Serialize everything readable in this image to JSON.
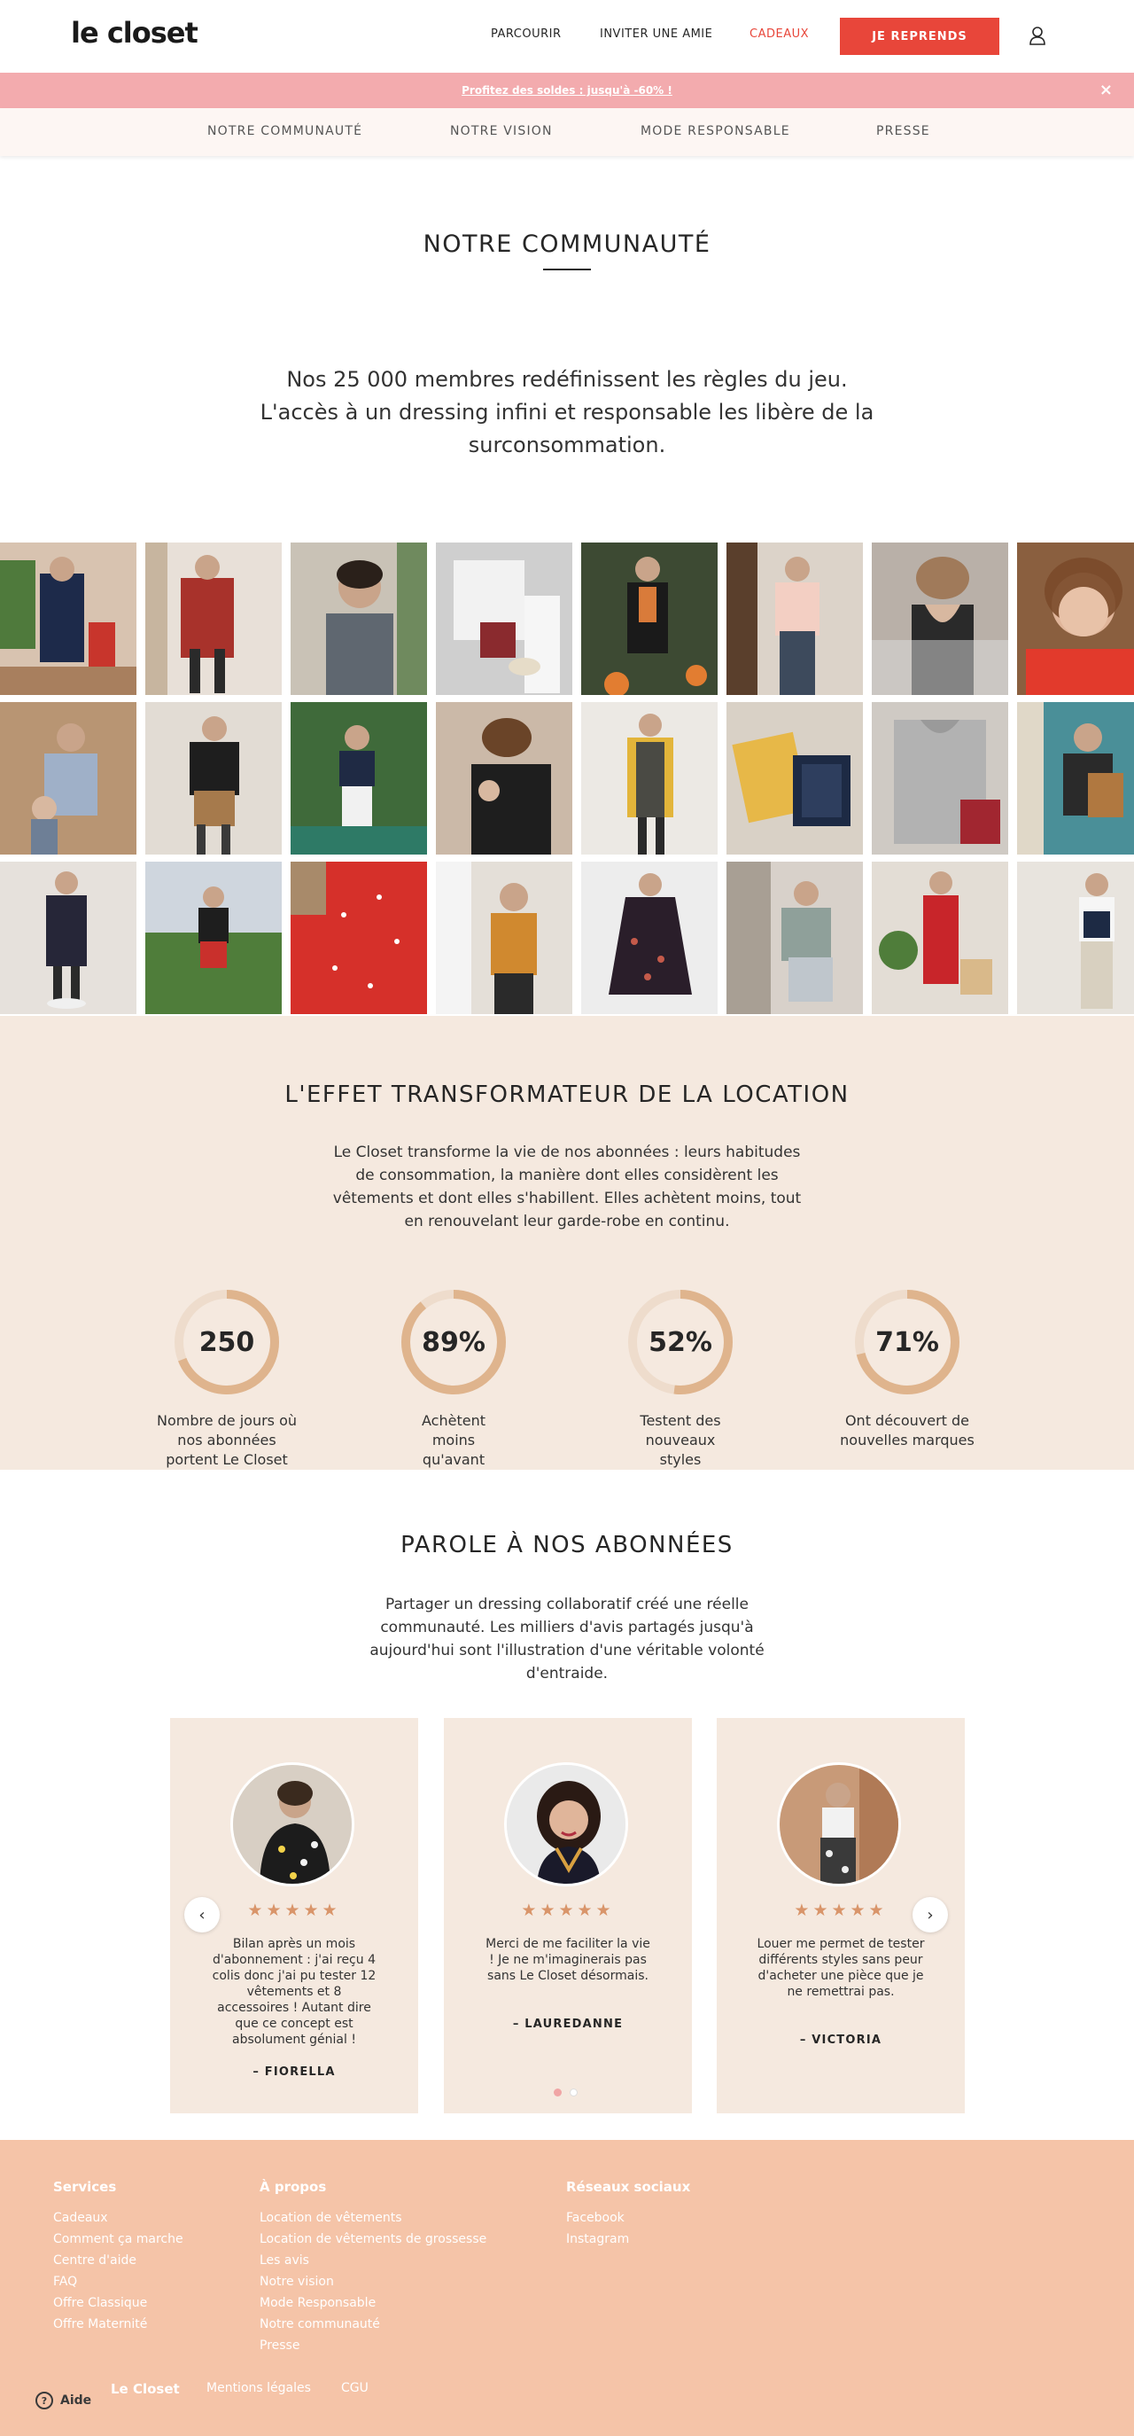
{
  "header": {
    "logo": "le closet",
    "nav": [
      "PARCOURIR",
      "INVITER UNE AMIE",
      "CADEAUX"
    ],
    "cta": "JE REPRENDS"
  },
  "promo": {
    "text": "Profitez des soldes : jusqu'à -60% !",
    "close": "×"
  },
  "subnav": [
    "NOTRE COMMUNAUTÉ",
    "NOTRE VISION",
    "MODE RESPONSABLE",
    "PRESSE"
  ],
  "community": {
    "title": "NOTRE COMMUNAUTÉ",
    "intro": "Nos 25 000 membres redéfinissent les règles du jeu. L'accès à un dressing infini et responsable les libère de la surconsommation."
  },
  "effect": {
    "title": "L'EFFET TRANSFORMATEUR DE LA LOCATION",
    "text": "Le Closet transforme la vie de nos abonnées : leurs habitudes de consommation, la manière dont elles considèrent les vêtements et dont elles s'habillent. Elles achètent moins, tout en renouvelant leur garde-robe en continu.",
    "stats": [
      {
        "value": "250",
        "label": "Nombre de jours où nos abonnées portent Le Closet",
        "fill": 0.69
      },
      {
        "value": "89%",
        "label": "Achètent moins qu'avant",
        "fill": 0.89
      },
      {
        "value": "52%",
        "label": "Testent des nouveaux styles",
        "fill": 0.52
      },
      {
        "value": "71%",
        "label": "Ont découvert de nouvelles marques",
        "fill": 0.71
      }
    ]
  },
  "testimonials": {
    "title": "PAROLE À NOS ABONNÉES",
    "text": "Partager un dressing collaboratif créé une réelle communauté. Les milliers d'avis partagés jusqu'à aujourd'hui sont l'illustration d'une véritable volonté d'entraide.",
    "stars": "★★★★★",
    "cards": [
      {
        "quote": "Bilan après un mois d'abonnement : j'ai reçu 4 colis donc j'ai pu tester 12 vêtements et 8 accessoires ! Autant dire que ce concept est absolument génial !",
        "author": "– FIORELLA"
      },
      {
        "quote": "Merci de me faciliter la vie ! Je ne m'imaginerais pas sans Le Closet désormais.",
        "author": "– LAUREDANNE"
      },
      {
        "quote": "Louer me permet de tester différents styles sans peur d'acheter une pièce que je ne remettrai pas.",
        "author": "– VICTORIA"
      }
    ],
    "prev": "‹",
    "next": "›"
  },
  "footer": {
    "services": {
      "title": "Services",
      "links": [
        "Cadeaux",
        "Comment ça marche",
        "Centre d'aide",
        "FAQ",
        "Offre Classique",
        "Offre Maternité"
      ]
    },
    "about": {
      "title": "À propos",
      "links": [
        "Location de vêtements",
        "Location de vêtements de grossesse",
        "Les avis",
        "Notre vision",
        "Mode Responsable",
        "Notre communauté",
        "Presse"
      ]
    },
    "social": {
      "title": "Réseaux sociaux",
      "links": [
        "Facebook",
        "Instagram"
      ]
    },
    "bottom": [
      "Le Closet",
      "Mentions légales",
      "CGU"
    ],
    "help": "Aide"
  },
  "colors": {
    "accent": "#e8463a",
    "promo": "#f3abae",
    "beige": "#f5e9df",
    "footer": "#f5c4a8",
    "ring": "#dfb48d"
  }
}
